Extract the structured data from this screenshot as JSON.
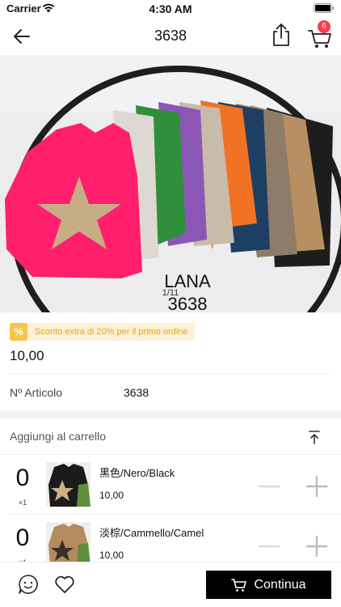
{
  "status_bar": {
    "carrier": "Carrier",
    "time": "4:30 AM",
    "icons": [
      "wifi-icon",
      "battery-icon"
    ]
  },
  "nav": {
    "title": "3638",
    "cart_badge": "6",
    "icons": [
      "back-arrow-icon",
      "share-icon",
      "cart-icon"
    ]
  },
  "product_image": {
    "caption_brand": "LANA",
    "caption_code": "3638",
    "counter": "1/11"
  },
  "promo": {
    "icon_glyph": "%",
    "text": "Sconto extra di 20% per il primo ordine",
    "colors": {
      "background": "#fdf1d5",
      "icon": "#f7c349",
      "text": "#e8a21a"
    }
  },
  "price": "10,00",
  "article": {
    "label": "Nº Articolo",
    "value": "3638"
  },
  "add_to_cart": {
    "title": "Aggiungi al carrello",
    "variants": [
      {
        "qty": "0",
        "unit": "×1",
        "name": "黑色/Nero/Black",
        "price": "10,00"
      },
      {
        "qty": "0",
        "unit": "×1",
        "name": "淡棕/Cammello/Camel",
        "price": "10,00"
      }
    ]
  },
  "bottom_bar": {
    "continue_label": "Continua",
    "icons": [
      "chat-icon",
      "heart-icon",
      "cart-icon"
    ]
  },
  "colors": {
    "badge": "#ff3b4a",
    "primary_button": "#000000",
    "section_gap": "#f2f2f4"
  }
}
